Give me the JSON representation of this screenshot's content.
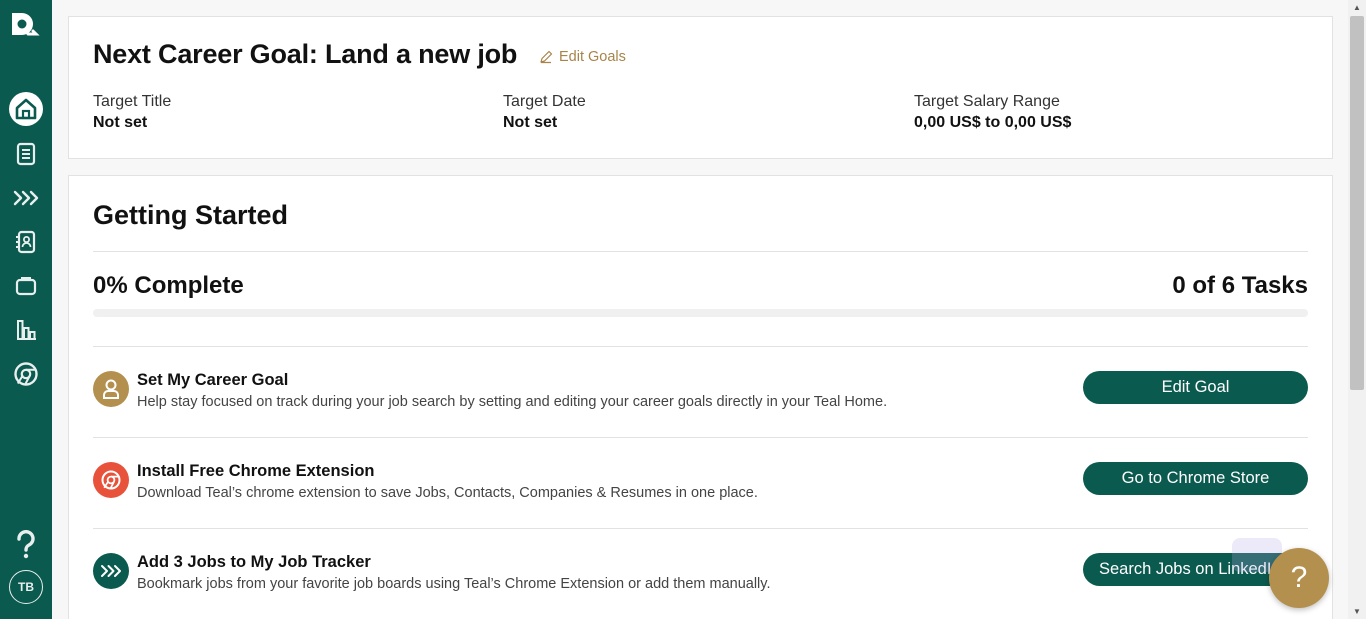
{
  "sidebar": {
    "avatar_initials": "TB",
    "icons": [
      "teal-logo-icon",
      "home-icon",
      "document-icon",
      "chevrons-icon",
      "contacts-icon",
      "briefcase-icon",
      "chart-icon",
      "chrome-icon",
      "help-icon"
    ]
  },
  "goal_card": {
    "title": "Next Career Goal: Land a new job",
    "edit_label": "Edit Goals",
    "fields": [
      {
        "label": "Target Title",
        "value": "Not set"
      },
      {
        "label": "Target Date",
        "value": "Not set"
      },
      {
        "label": "Target Salary Range",
        "value": "0,00 US$ to 0,00 US$"
      }
    ]
  },
  "getting_started": {
    "title": "Getting Started",
    "percent_label": "0% Complete",
    "tasks_label": "0 of 6 Tasks",
    "progress_fraction": 0,
    "tasks": [
      {
        "title": "Set My Career Goal",
        "description": "Help stay focused on track during your job search by setting and editing your career goals directly in your Teal Home.",
        "button": "Edit Goal",
        "icon": "person-icon",
        "icon_color": "#b4904f"
      },
      {
        "title": "Install Free Chrome Extension",
        "description": "Download Teal’s chrome extension to save Jobs, Contacts, Companies & Resumes in one place.",
        "button": "Go to Chrome Store",
        "icon": "chrome-icon",
        "icon_color": "#e8513a"
      },
      {
        "title": "Add 3 Jobs to My Job Tracker",
        "description": "Bookmark jobs from your favorite job boards using Teal’s Chrome Extension or add them manually.",
        "button": "Search Jobs on LinkedIn",
        "icon": "chevrons-icon",
        "icon_color": "#0b5a4f"
      }
    ]
  },
  "help_button": "?",
  "colors": {
    "sidebar": "#0b5a4f",
    "accent_gold": "#b4904f",
    "button": "#0b5a4f"
  }
}
